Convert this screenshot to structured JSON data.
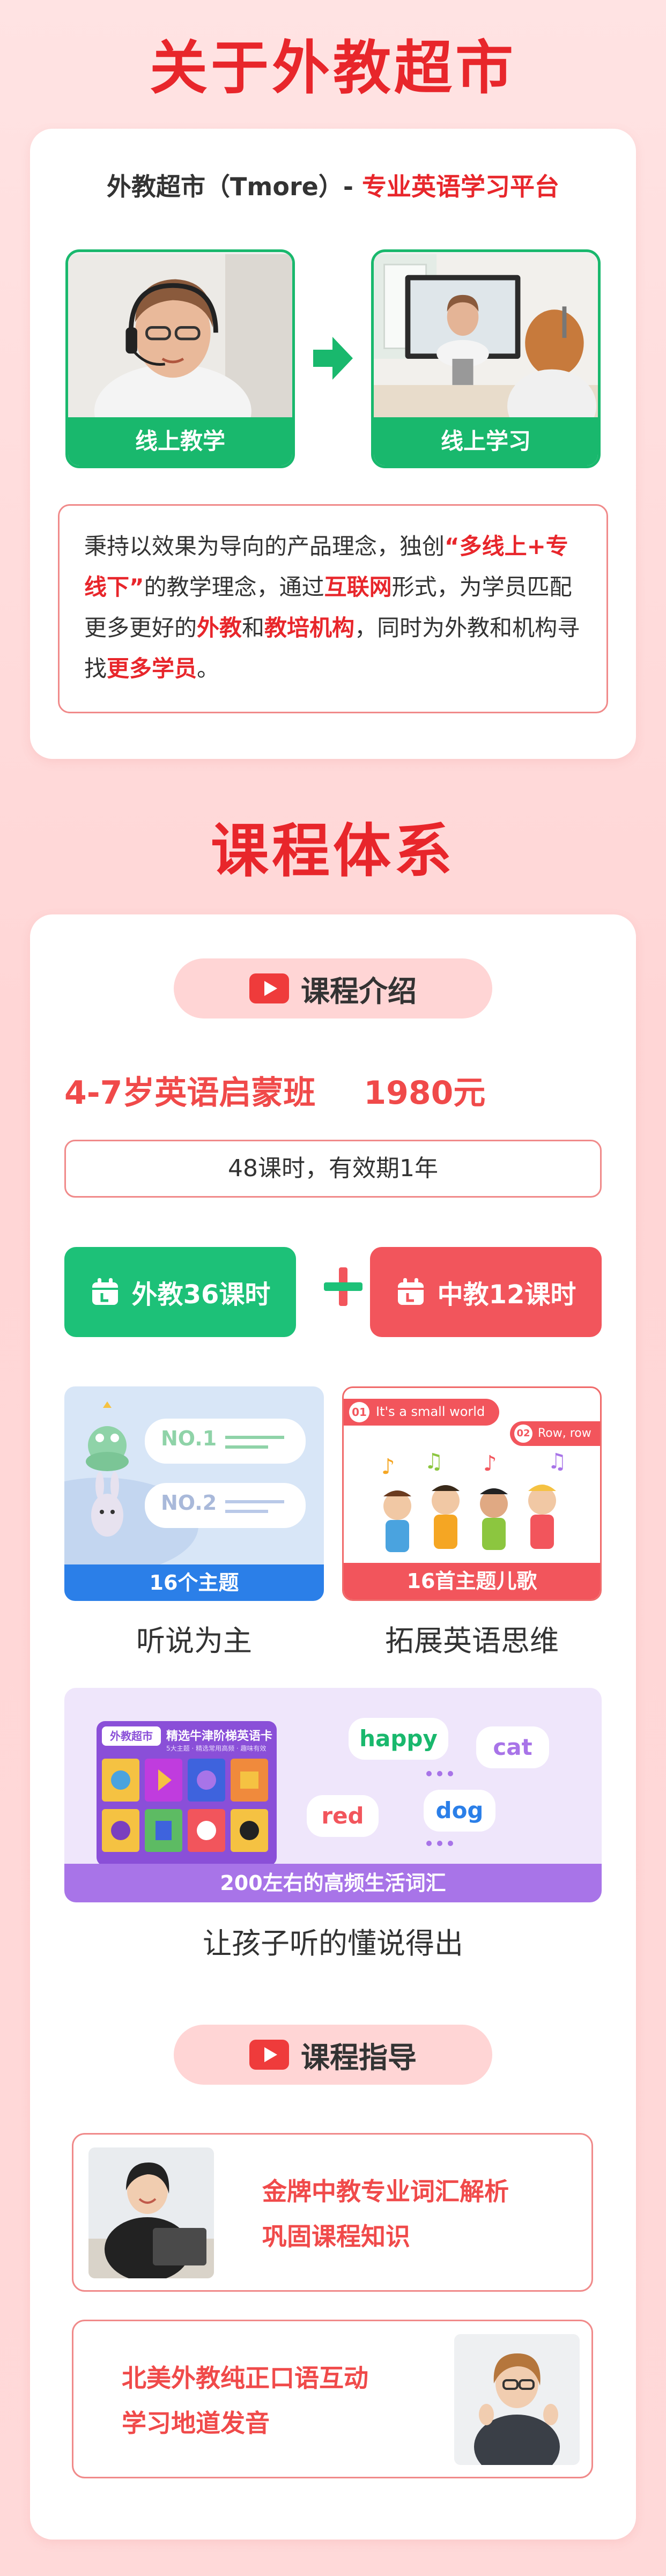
{
  "about": {
    "title": "关于外教超市",
    "heading_prefix": "外教超市（Tmore）- ",
    "heading_highlight": "专业英语学习平台",
    "online_teaching": "线上教学",
    "online_learning": "线上学习",
    "intro": [
      {
        "t": "秉持以效果为导向的产品理念，独创",
        "h": false
      },
      {
        "t": "“多线上+专线下”",
        "h": true
      },
      {
        "t": "的教学理念，通过",
        "h": false
      },
      {
        "t": "互联网",
        "h": true
      },
      {
        "t": "形式，为学员匹配更多更好的",
        "h": false
      },
      {
        "t": "外教",
        "h": true
      },
      {
        "t": "和",
        "h": false
      },
      {
        "t": "教培机构",
        "h": true
      },
      {
        "t": "，同时为外教和机构寻找",
        "h": false
      },
      {
        "t": "更多学员",
        "h": true
      },
      {
        "t": "。",
        "h": false
      }
    ]
  },
  "course": {
    "title": "课程体系",
    "intro_pill": "课程介绍",
    "class_name": "4-7岁英语启蒙班",
    "price": "1980元",
    "lessons": "48课时，有效期1年",
    "foreign_hours": "外教36课时",
    "chinese_hours": "中教12课时",
    "topics_caption": "16个主题",
    "songs_caption": "16首主题儿歌",
    "listen_speak": "听说为主",
    "thinking": "拓展英语思维",
    "vocab_caption": "200左右的高频生活词汇",
    "vocab_summary": "让孩子听的懂说得出",
    "no1": "NO.1",
    "no2": "NO.2",
    "song1": "It's a small world",
    "song2": "Row, row",
    "song1_num": "01",
    "song2_num": "02",
    "words": [
      "happy",
      "cat",
      "red",
      "dog"
    ],
    "book_tag": "外教超市",
    "book_title": "精选牛津阶梯英语卡",
    "book_sub": "5大主题 · 精选常用高频 · 趣味有效"
  },
  "guide": {
    "pill": "课程指导",
    "item1_line1": "金牌中教专业词汇解析",
    "item1_line2": "巩固课程知识",
    "item2_line1": "北美外教纯正口语互动",
    "item2_line2": "学习地道发音"
  },
  "colors": {
    "brand_red": "#e8262b",
    "green": "#19b86d",
    "blue": "#2b7fe8",
    "purple": "#a874e8"
  }
}
